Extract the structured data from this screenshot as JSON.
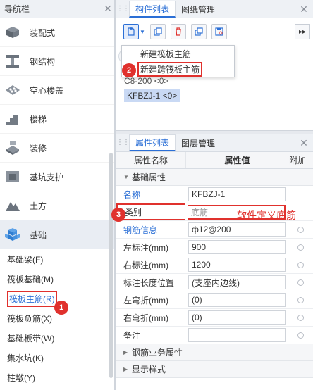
{
  "nav": {
    "title": "导航栏",
    "categories": [
      {
        "label": "装配式",
        "icon": "prefab-icon"
      },
      {
        "label": "钢结构",
        "icon": "steel-beam-icon"
      },
      {
        "label": "空心楼盖",
        "icon": "hollow-slab-icon"
      },
      {
        "label": "楼梯",
        "icon": "stairs-icon"
      },
      {
        "label": "装修",
        "icon": "decoration-icon"
      },
      {
        "label": "基坑支护",
        "icon": "pit-support-icon"
      },
      {
        "label": "土方",
        "icon": "earthwork-icon"
      },
      {
        "label": "基础",
        "icon": "foundation-icon"
      }
    ],
    "sub_items": [
      "基础梁(F)",
      "筏板基础(M)",
      "筏板主筋(R)",
      "筏板负筋(X)",
      "基础板带(W)",
      "集水坑(K)",
      "柱墩(Y)"
    ],
    "active_sub_index": 2
  },
  "component_panel": {
    "tabs": [
      "构件列表",
      "图纸管理"
    ],
    "active_tab": 0,
    "menu_items": [
      "新建筏板主筋",
      "新建跨筏板主筋"
    ],
    "highlighted_menu_index": 1,
    "items": [
      "C8-200 <0>",
      "KFBZJ-1 <0>"
    ],
    "selected_item_index": 1
  },
  "property_panel": {
    "tabs": [
      "属性列表",
      "图层管理"
    ],
    "active_tab": 0,
    "columns": [
      "属性名称",
      "属性值",
      "附加"
    ],
    "group_basic": "基础属性",
    "rows": [
      {
        "name": "名称",
        "value": "KFBZJ-1",
        "blue": true,
        "radio": false
      },
      {
        "name": "类别",
        "value": "底筋",
        "blue": false,
        "radio": false
      },
      {
        "name": "钢筋信息",
        "value": "ф12@200",
        "blue": true,
        "radio": true
      },
      {
        "name": "左标注(mm)",
        "value": "900",
        "blue": false,
        "radio": true
      },
      {
        "name": "右标注(mm)",
        "value": "1200",
        "blue": false,
        "radio": true
      },
      {
        "name": "标注长度位置",
        "value": "(支座内边线)",
        "blue": false,
        "radio": true
      },
      {
        "name": "左弯折(mm)",
        "value": "(0)",
        "blue": false,
        "radio": true
      },
      {
        "name": "右弯折(mm)",
        "value": "(0)",
        "blue": false,
        "radio": true
      },
      {
        "name": "备注",
        "value": "",
        "blue": false,
        "radio": true
      }
    ],
    "group_rebar": "钢筋业务属性",
    "group_style": "显示样式"
  },
  "annotations": {
    "markers": [
      "1",
      "2",
      "3"
    ],
    "note": "软件定义底筋"
  },
  "colors": {
    "accent": "#2b6fd6",
    "highlight": "#e0312d",
    "selection": "#c9d9f4"
  }
}
